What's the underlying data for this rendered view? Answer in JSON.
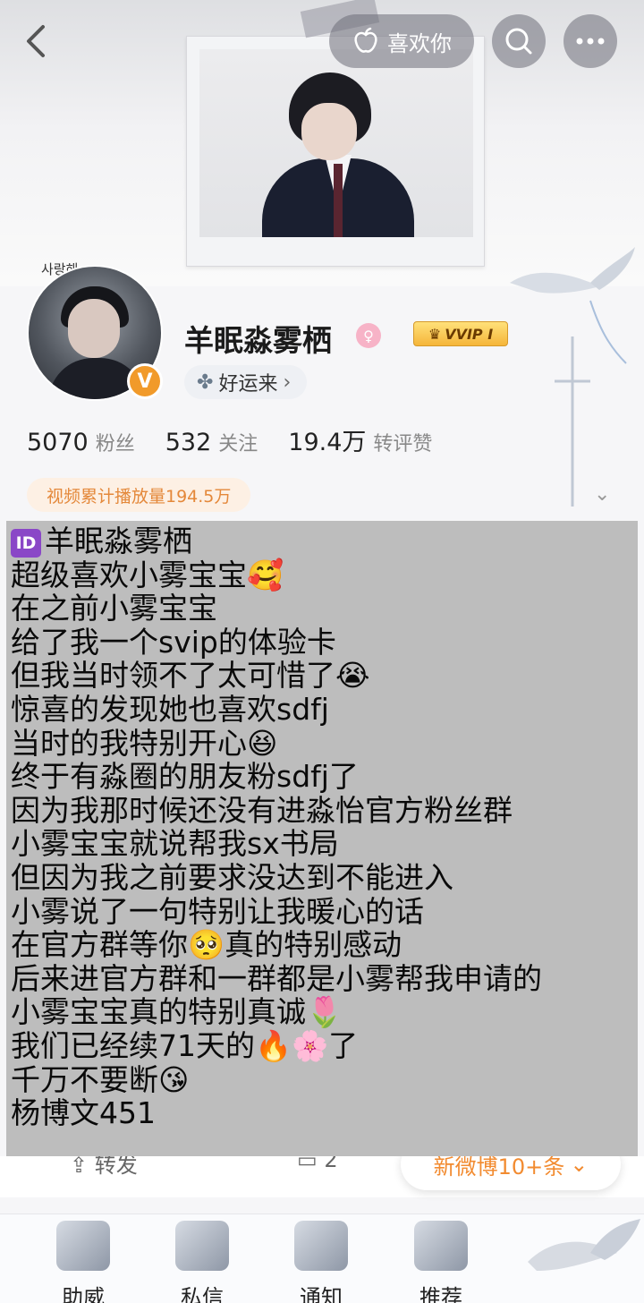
{
  "header": {
    "back_icon": "chevron-left-icon",
    "like_label": "喜欢你",
    "like_icon": "apple-outline-icon",
    "search_icon": "search-icon",
    "more_icon": "more-dots-icon"
  },
  "profile": {
    "avatar_caption": "사랑해",
    "verified_badge": "V",
    "username": "羊眠淼雾栖",
    "gender_icon": "female-icon",
    "vip_label": "VVIP I",
    "luck_tag": "好运来",
    "stats": [
      {
        "value": "5070",
        "label": "粉丝"
      },
      {
        "value": "532",
        "label": "关注"
      },
      {
        "value": "19.4万",
        "label": "转评赞"
      }
    ],
    "video_tag": "视频累计播放量194.5万"
  },
  "post": {
    "id_badge": "ID",
    "lines": [
      "羊眠淼雾栖",
      "超级喜欢小雾宝宝🥰",
      "在之前小雾宝宝",
      "给了我一个svip的体验卡",
      "但我当时领不了太可惜了😭",
      "惊喜的发现她也喜欢sdfj",
      "当时的我特别开心😆",
      "终于有淼圈的朋友粉sdfj了",
      "因为我那时候还没有进淼怡官方粉丝群",
      "小雾宝宝就说帮我sx书局",
      "但因为我之前要求没达到不能进入",
      "小雾说了一句特别让我暖心的话",
      "在官方群等你🥺真的特别感动",
      "后来进官方群和一群都是小雾帮我申请的",
      "小雾宝宝真的特别真诚🌷",
      "我们已经续71天的🔥🌸了",
      "千万不要断😘",
      "杨博文451"
    ]
  },
  "feed_bar": {
    "repost": "转发",
    "comment_count": "2",
    "new_posts": "新微博10+条"
  },
  "tabbar": {
    "items": [
      "助威",
      "私信",
      "通知",
      "推荐"
    ]
  }
}
